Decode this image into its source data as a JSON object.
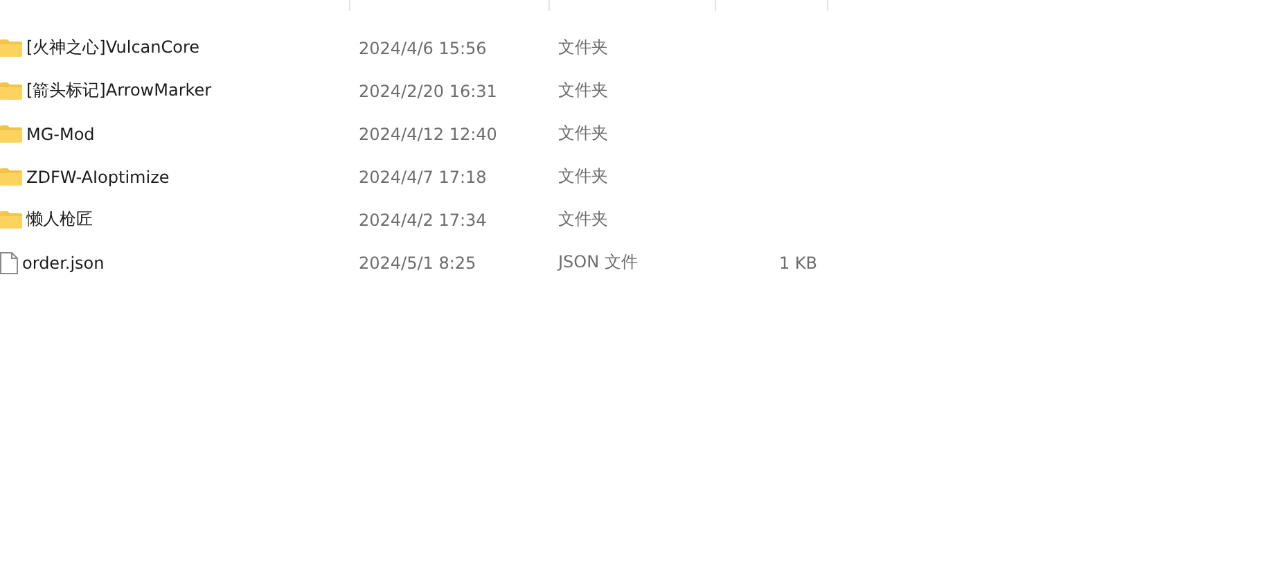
{
  "files": [
    {
      "kind": "folder",
      "name": "[火神之心]VulcanCore",
      "modified": "2024/4/6 15:56",
      "type": "文件夹"
    },
    {
      "kind": "folder",
      "name": "[箭头标记]ArrowMarker",
      "modified": "2024/2/20 16:31",
      "type": "文件夹"
    },
    {
      "kind": "folder",
      "name": "MG-Mod",
      "modified": "2024/4/12 12:40",
      "type": "文件夹"
    },
    {
      "kind": "folder",
      "name": "ZDFW-AIoptimize",
      "modified": "2024/4/7 17:18",
      "type": "文件夹"
    },
    {
      "kind": "folder",
      "name": "懒人枪匠",
      "modified": "2024/4/2 17:34",
      "type": "文件夹"
    },
    {
      "kind": "file",
      "name": "order.json",
      "modified": "2024/5/1 8:25",
      "type": "JSON 文件",
      "size": "1 KB"
    }
  ]
}
